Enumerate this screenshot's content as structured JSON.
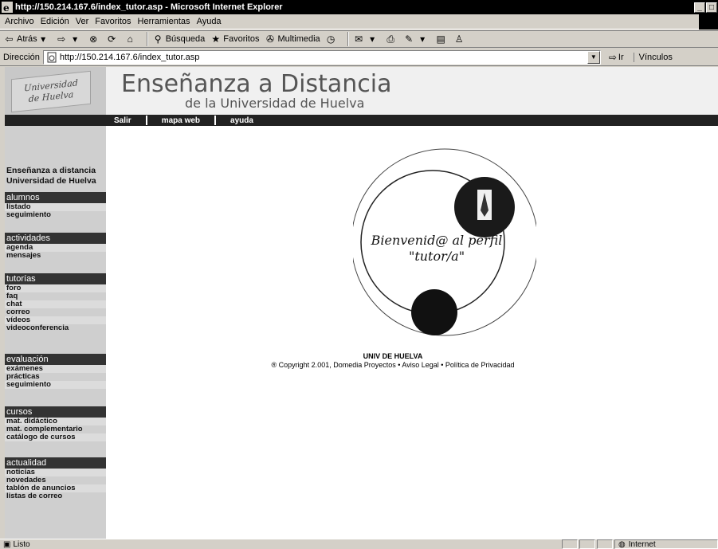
{
  "window": {
    "title": "http://150.214.167.6/index_tutor.asp - Microsoft Internet Explorer",
    "controls": [
      "_",
      "□"
    ]
  },
  "menubar": [
    "Archivo",
    "Edición",
    "Ver",
    "Favoritos",
    "Herramientas",
    "Ayuda"
  ],
  "toolbar": {
    "back": "Atrás",
    "search": "Búsqueda",
    "favorites": "Favoritos",
    "multimedia": "Multimedia"
  },
  "address": {
    "label": "Dirección",
    "url": "http://150.214.167.6/index_tutor.asp",
    "go": "Ir",
    "links": "Vínculos"
  },
  "header": {
    "logo_line1": "Universidad",
    "logo_line2": "de Huelva",
    "title": "Enseñanza a Distancia",
    "subtitle": "de la Universidad de Huelva"
  },
  "topnav": [
    "Salir",
    "mapa web",
    "ayuda"
  ],
  "sidebar": {
    "brand": "Enseñanza a distancia Universidad de Huelva",
    "sections": [
      {
        "title": "alumnos",
        "items": [
          "listado",
          "seguimiento"
        ]
      },
      {
        "title": "actividades",
        "items": [
          "agenda",
          "mensajes"
        ]
      },
      {
        "title": "tutorías",
        "items": [
          "foro",
          "faq",
          "chat",
          "correo",
          "vídeos",
          "videoconferencia"
        ]
      },
      {
        "title": "evaluación",
        "items": [
          "exámenes",
          "prácticas",
          "seguimiento"
        ]
      },
      {
        "title": "cursos",
        "items": [
          "mat. didáctico",
          "mat. complementario",
          "catálogo de cursos"
        ]
      },
      {
        "title": "actualidad",
        "items": [
          "noticias",
          "novedades",
          "tablón de anuncios",
          "listas de correo"
        ]
      }
    ]
  },
  "main": {
    "welcome_line1": "Bienvenid@ al perfil",
    "welcome_line2": "\"tutor/a\"",
    "org": "UNIV DE HUELVA",
    "copyright": "® Copyright 2.001, Domedia Proyectos • Aviso Legal • Política de Privacidad"
  },
  "status": {
    "text": "Listo",
    "zone": "Internet"
  }
}
